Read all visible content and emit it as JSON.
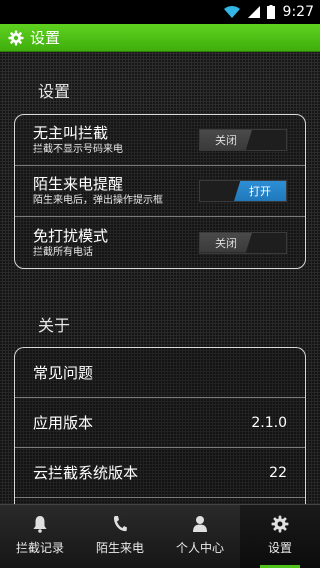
{
  "status_bar": {
    "time": "9:27"
  },
  "title_bar": {
    "title": "设置",
    "icon": "gear-icon"
  },
  "settings_section": {
    "heading": "设置",
    "rows": [
      {
        "title": "无主叫拦截",
        "subtitle": "拦截不显示号码来电",
        "toggle_label": "关闭",
        "on": false
      },
      {
        "title": "陌生来电提醒",
        "subtitle": "陌生来电后，弹出操作提示框",
        "toggle_label": "打开",
        "on": true
      },
      {
        "title": "免打扰模式",
        "subtitle": "拦截所有电话",
        "toggle_label": "关闭",
        "on": false
      }
    ]
  },
  "about_section": {
    "heading": "关于",
    "rows": [
      {
        "label": "常见问题",
        "value": ""
      },
      {
        "label": "应用版本",
        "value": "2.1.0"
      },
      {
        "label": "云拦截系统版本",
        "value": "22"
      }
    ]
  },
  "tab_bar": {
    "tabs": [
      {
        "label": "拦截记录",
        "icon": "bell-icon",
        "active": false
      },
      {
        "label": "陌生来电",
        "icon": "phone-icon",
        "active": false
      },
      {
        "label": "个人中心",
        "icon": "person-icon",
        "active": false
      },
      {
        "label": "设置",
        "icon": "gear-icon",
        "active": true
      }
    ]
  },
  "colors": {
    "accent_green": "#4ec21a",
    "toggle_on_blue": "#2e8fd6"
  }
}
